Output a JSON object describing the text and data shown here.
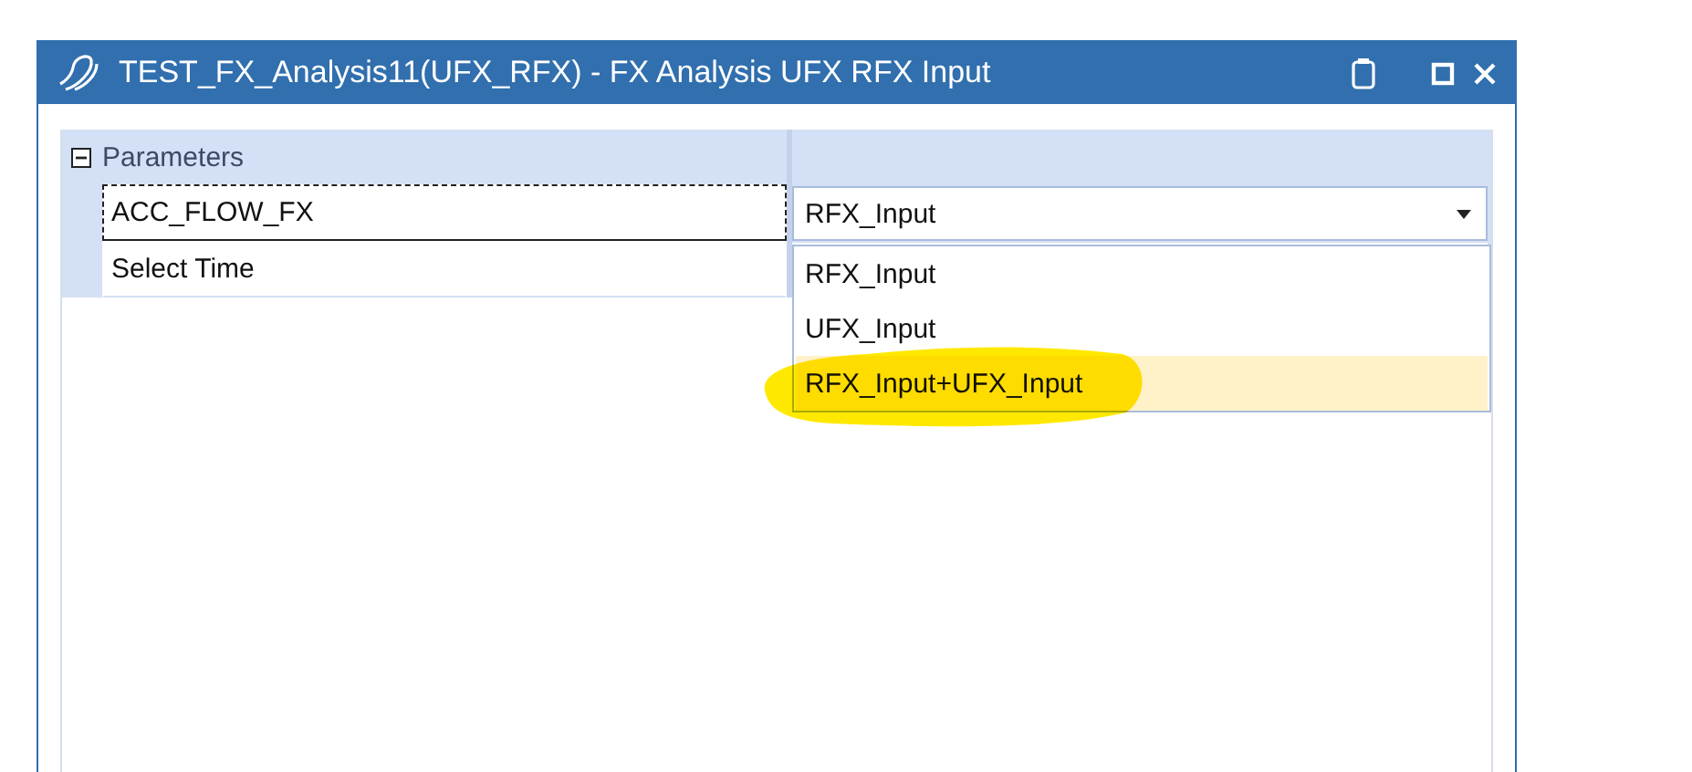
{
  "window": {
    "title": "TEST_FX_Analysis11(UFX_RFX) - FX Analysis UFX RFX Input"
  },
  "grid": {
    "category": {
      "label": "Parameters",
      "expanded": true
    },
    "rows": [
      {
        "label": "ACC_FLOW_FX",
        "focused": true,
        "kind": "dropdown",
        "value": "RFX_Input"
      },
      {
        "label": "Select Time",
        "focused": false,
        "kind": "empty"
      }
    ]
  },
  "dropdown_list": {
    "open": true,
    "options": [
      {
        "label": "RFX_Input",
        "highlighted": false
      },
      {
        "label": "UFX_Input",
        "highlighted": false
      },
      {
        "label": "RFX_Input+UFX_Input",
        "highlighted": true
      }
    ]
  }
}
